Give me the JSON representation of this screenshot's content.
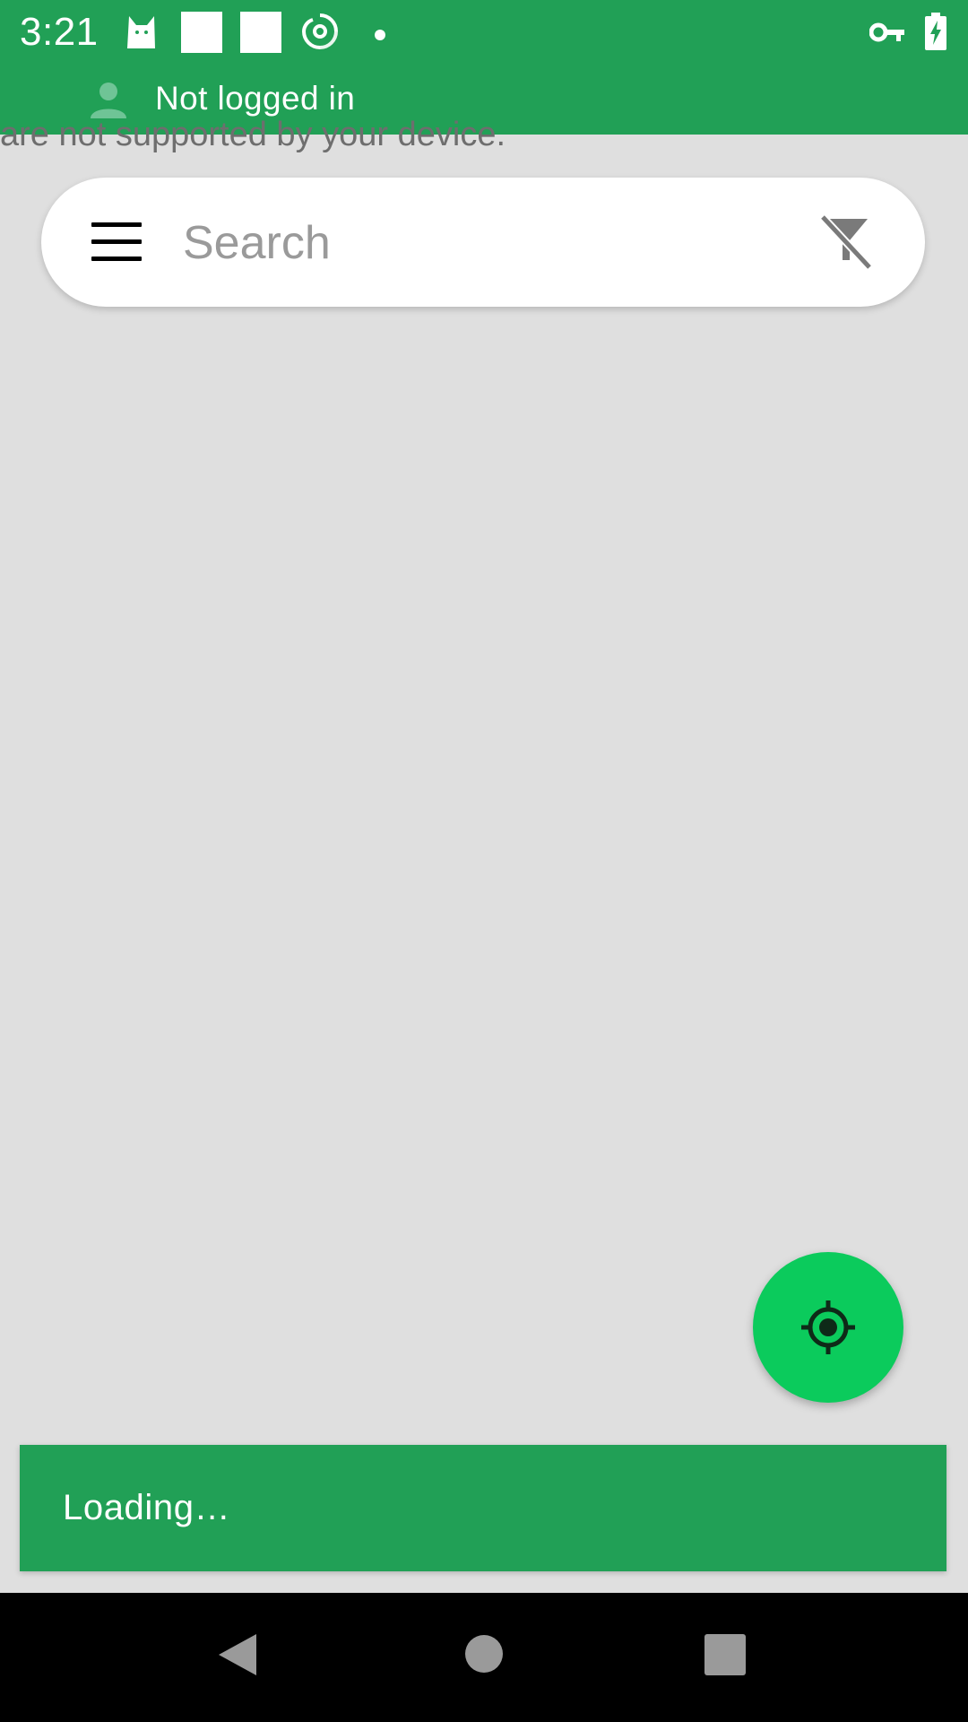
{
  "status_bar": {
    "time": "3:21",
    "left_icons": [
      "cat-icon",
      "blank-square-icon",
      "blank-square-icon",
      "spiral-icon",
      "dot-icon"
    ],
    "right_icons": [
      "key-icon",
      "battery-charging-icon"
    ]
  },
  "login_bar": {
    "avatar_icon": "person-icon",
    "label": "Not logged in"
  },
  "background_text": "are not supported by your device.",
  "search": {
    "placeholder": "Search",
    "value": "",
    "menu_icon": "hamburger-menu-icon",
    "filter_icon": "filter-off-icon"
  },
  "fab": {
    "icon": "my-location-icon"
  },
  "snackbar": {
    "message": "Loading…"
  },
  "nav_bar": {
    "buttons": [
      "back-triangle-icon",
      "home-circle-icon",
      "recents-square-icon"
    ]
  },
  "colors": {
    "primary": "#21a056",
    "accent": "#0bcb5c",
    "background": "#dfdfdf",
    "surface": "#ffffff"
  }
}
